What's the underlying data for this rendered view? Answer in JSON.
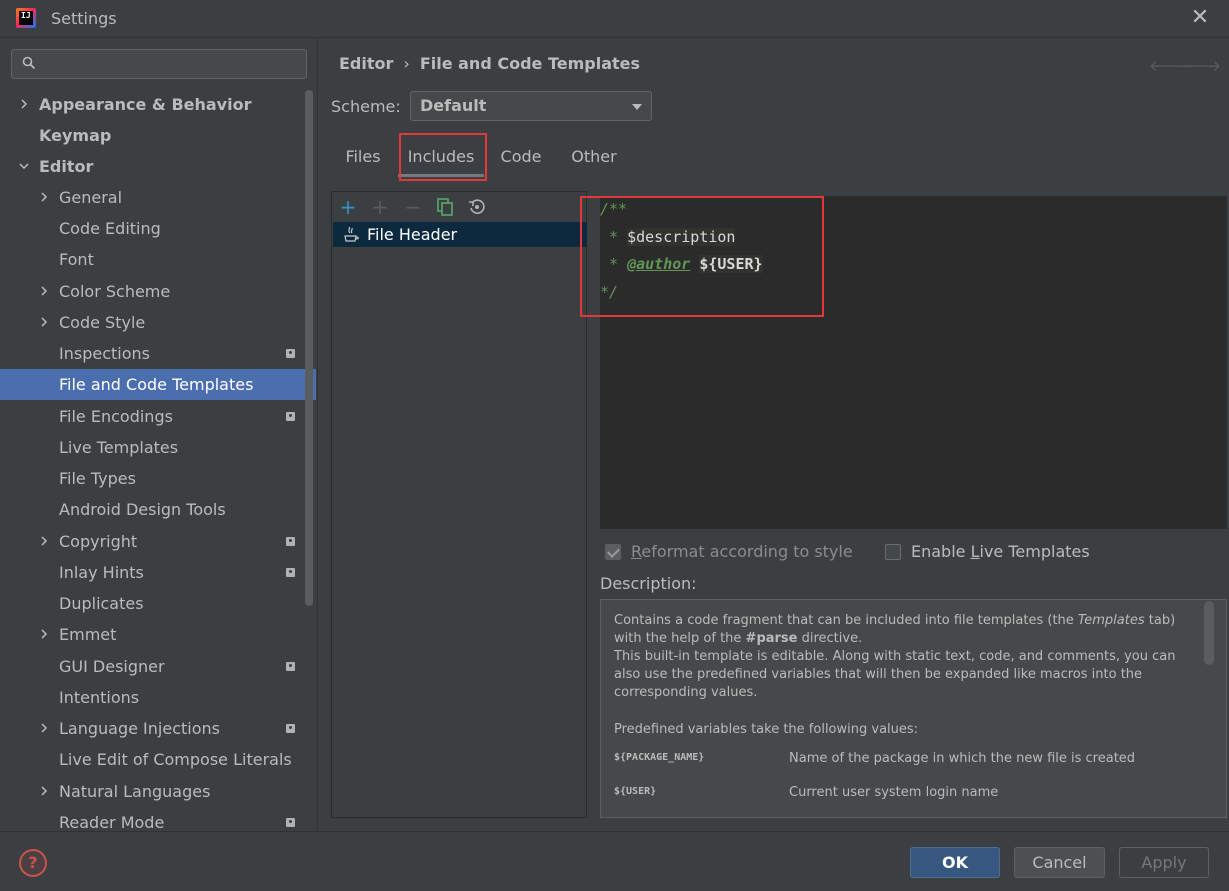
{
  "window": {
    "title": "Settings",
    "app_icon_text": "IJ"
  },
  "search": {
    "placeholder": ""
  },
  "sidebar": {
    "items": [
      {
        "label": "Appearance & Behavior",
        "expandable": true,
        "expanded": false
      },
      {
        "label": "Keymap"
      },
      {
        "label": "Editor",
        "expandable": true,
        "expanded": true
      },
      {
        "label": "General",
        "expandable": true
      },
      {
        "label": "Code Editing"
      },
      {
        "label": "Font"
      },
      {
        "label": "Color Scheme",
        "expandable": true
      },
      {
        "label": "Code Style",
        "expandable": true
      },
      {
        "label": "Inspections",
        "badge": true
      },
      {
        "label": "File and Code Templates",
        "selected": true
      },
      {
        "label": "File Encodings",
        "badge": true
      },
      {
        "label": "Live Templates"
      },
      {
        "label": "File Types"
      },
      {
        "label": "Android Design Tools"
      },
      {
        "label": "Copyright",
        "expandable": true,
        "badge": true
      },
      {
        "label": "Inlay Hints",
        "badge": true
      },
      {
        "label": "Duplicates"
      },
      {
        "label": "Emmet",
        "expandable": true
      },
      {
        "label": "GUI Designer",
        "badge": true
      },
      {
        "label": "Intentions"
      },
      {
        "label": "Language Injections",
        "expandable": true,
        "badge": true
      },
      {
        "label": "Live Edit of Compose Literals"
      },
      {
        "label": "Natural Languages",
        "expandable": true
      },
      {
        "label": "Reader Mode",
        "badge": true
      }
    ]
  },
  "breadcrumb": {
    "parent": "Editor",
    "separator": "›",
    "current": "File and Code Templates"
  },
  "scheme": {
    "label": "Scheme:",
    "value": "Default"
  },
  "tabs": [
    {
      "label": "Files"
    },
    {
      "label": "Includes",
      "active": true
    },
    {
      "label": "Code"
    },
    {
      "label": "Other"
    }
  ],
  "template_list": {
    "items": [
      {
        "label": "File Header",
        "icon": "java-icon"
      }
    ]
  },
  "editor": {
    "line1": "/**",
    "line2_prefix": " * ",
    "line2_var": "$description",
    "line3_prefix": " * ",
    "line3_tag": "@author",
    "line3_var": "${USER}",
    "line4": "*/"
  },
  "options": {
    "reformat_pre": "",
    "reformat_u": "R",
    "reformat_post": "eformat according to style",
    "reformat_checked": true,
    "live_pre": "Enable ",
    "live_u": "L",
    "live_post": "ive Templates",
    "live_checked": false
  },
  "description": {
    "label": "Description:",
    "p1_a": "Contains a code fragment that can be included into file templates (the ",
    "p1_em": "Templates",
    "p1_b": " tab) with the help of the ",
    "p1_strong": "#parse",
    "p1_c": " directive.",
    "p2": "This built-in template is editable. Along with static text, code, and comments, you can also use the predefined variables that will then be expanded like macros into the corresponding values.",
    "p3": "Predefined variables take the following values:",
    "vars": [
      {
        "name": "${PACKAGE_NAME}",
        "desc": "Name of the package in which the new file is created"
      },
      {
        "name": "${USER}",
        "desc": "Current user system login name"
      }
    ]
  },
  "buttons": {
    "ok": "OK",
    "cancel": "Cancel",
    "apply": "Apply",
    "help": "?"
  },
  "colors": {
    "accent": "#4b6eaf",
    "highlight_red": "#e0393b",
    "comment_green": "#629755"
  }
}
